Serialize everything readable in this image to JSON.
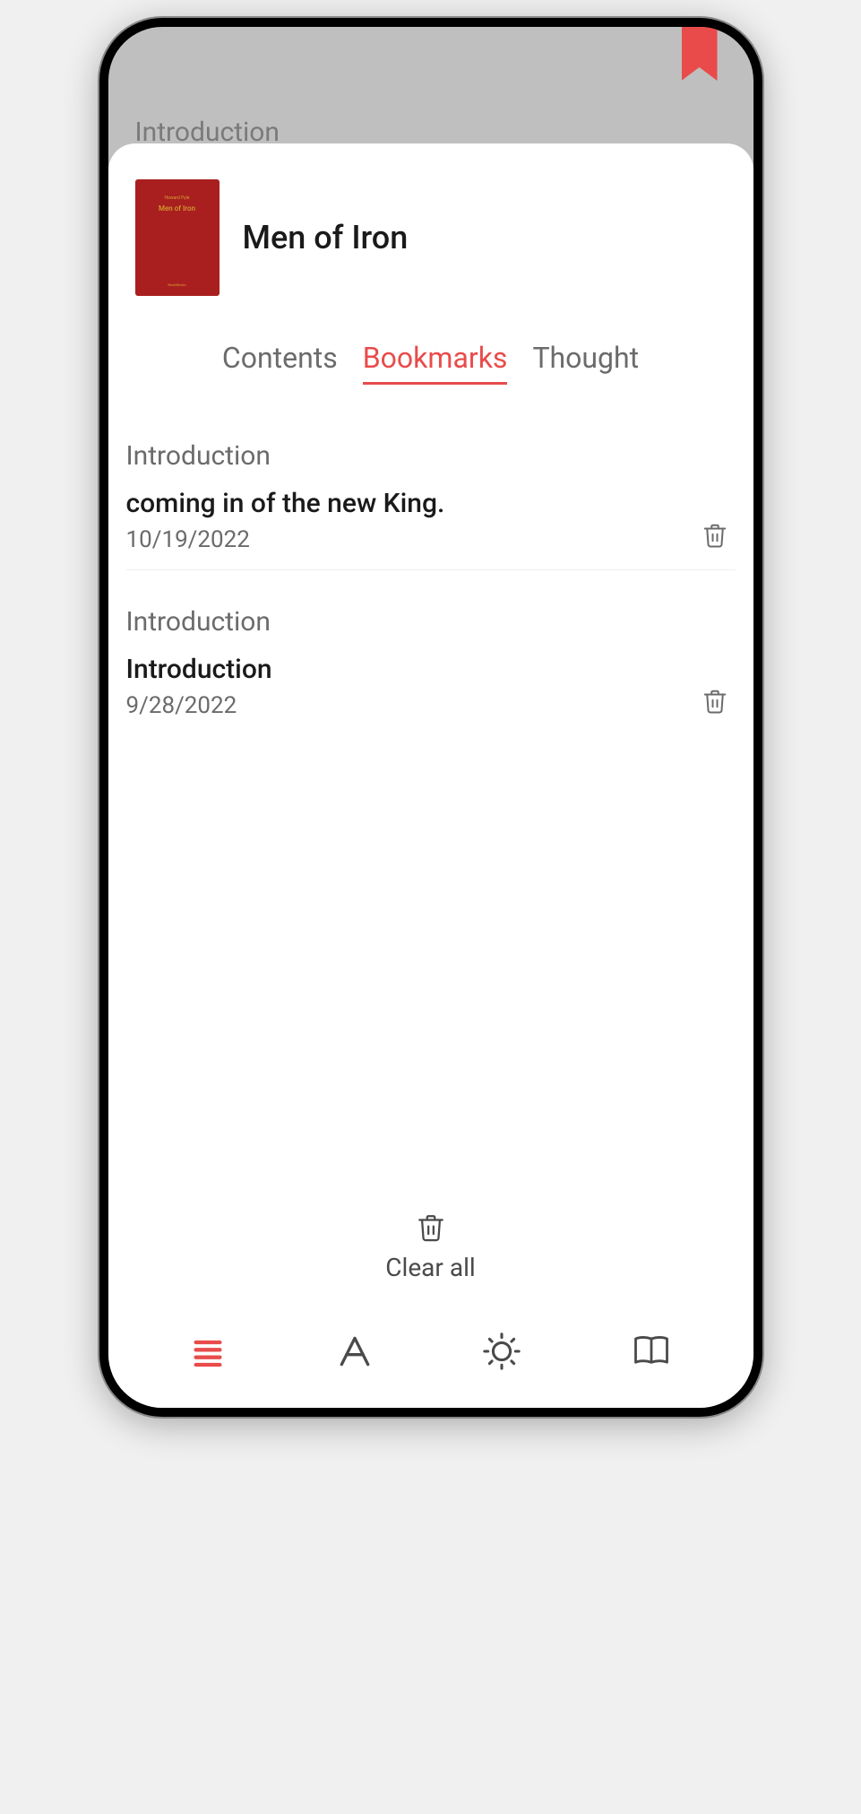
{
  "background_chapter": "Introduction",
  "book": {
    "title": "Men of Iron",
    "cover": {
      "author": "Howard Pyle",
      "title": "Men of Iron",
      "imprint": "BookBooks"
    }
  },
  "tabs": {
    "contents": "Contents",
    "bookmarks": "Bookmarks",
    "thought": "Thought"
  },
  "bookmarks": [
    {
      "chapter": "Introduction",
      "text": "coming in of the new King.",
      "date": "10/19/2022"
    },
    {
      "chapter": "Introduction",
      "text": "Introduction",
      "date": "9/28/2022"
    }
  ],
  "clear_all_label": "Clear all"
}
